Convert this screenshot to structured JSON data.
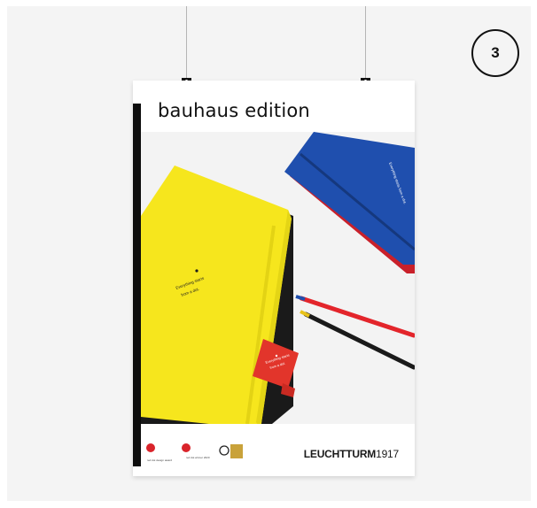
{
  "badge": {
    "number": "3"
  },
  "poster": {
    "title": "bauhaus edition",
    "notebook_text": "Everything starts\nfrom a dot.",
    "pen_loop_text": "Everything starts\nfrom a dot.",
    "awards": [
      {
        "label": "red dot design award\nwinner 2019"
      },
      {
        "label": "red dot winner 2020"
      },
      {
        "label": "GERMAN DESIGN AWARD\nGOLD 2021"
      }
    ],
    "brand": {
      "name": "LEUCHTTURM",
      "year": "1917"
    }
  },
  "colors": {
    "yellow": "#f6e61d",
    "blue": "#1f4fae",
    "red": "#e2352b",
    "background": "#f4f4f4"
  }
}
